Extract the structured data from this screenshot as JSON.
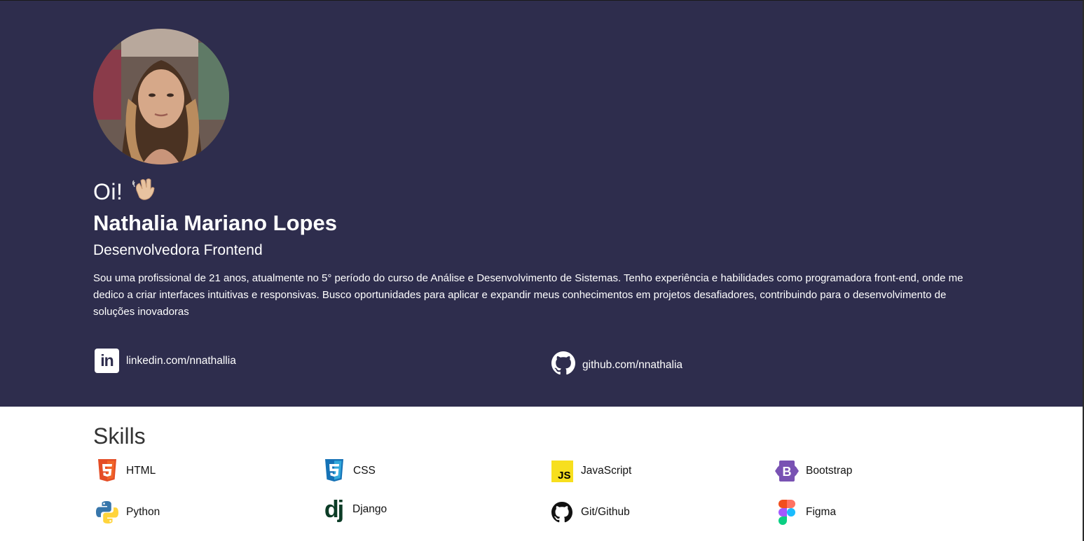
{
  "profile": {
    "greeting": "Oi!",
    "greeting_emoji_icon": "waving-hand-icon",
    "name": "Nathalia Mariano Lopes",
    "role": "Desenvolvedora Frontend",
    "bio": "Sou uma profissional de 21 anos, atualmente no 5° período do curso de Análise e Desenvolvimento de Sistemas. Tenho experiência e habilidades como programadora front-end, onde me dedico a criar interfaces intuitivas e responsivas. Busco oportunidades para aplicar e expandir meus conhecimentos em projetos desafiadores, contribuindo para o desenvolvimento de soluções inovadoras"
  },
  "contacts": {
    "linkedin": {
      "label": "linkedin.com/nnathallia",
      "icon": "linkedin-icon"
    },
    "github": {
      "label": "github.com/nnathalia",
      "icon": "github-icon"
    }
  },
  "skills": {
    "title": "Skills",
    "items": [
      {
        "label": "HTML",
        "icon": "html5-icon"
      },
      {
        "label": "CSS",
        "icon": "css3-icon"
      },
      {
        "label": "JavaScript",
        "icon": "javascript-icon",
        "icon_text": "JS"
      },
      {
        "label": "Bootstrap",
        "icon": "bootstrap-icon",
        "icon_text": "B"
      },
      {
        "label": "Python",
        "icon": "python-icon"
      },
      {
        "label": "Django",
        "icon": "django-icon",
        "icon_text": "dj"
      },
      {
        "label": "Git/Github",
        "icon": "github-icon"
      },
      {
        "label": "Figma",
        "icon": "figma-icon"
      }
    ]
  },
  "colors": {
    "hero_background": "#2e2d4d",
    "text_light": "#ffffff",
    "html": "#e44d26",
    "css": "#1572b6",
    "javascript": "#f7df1e",
    "bootstrap": "#7952b3"
  }
}
